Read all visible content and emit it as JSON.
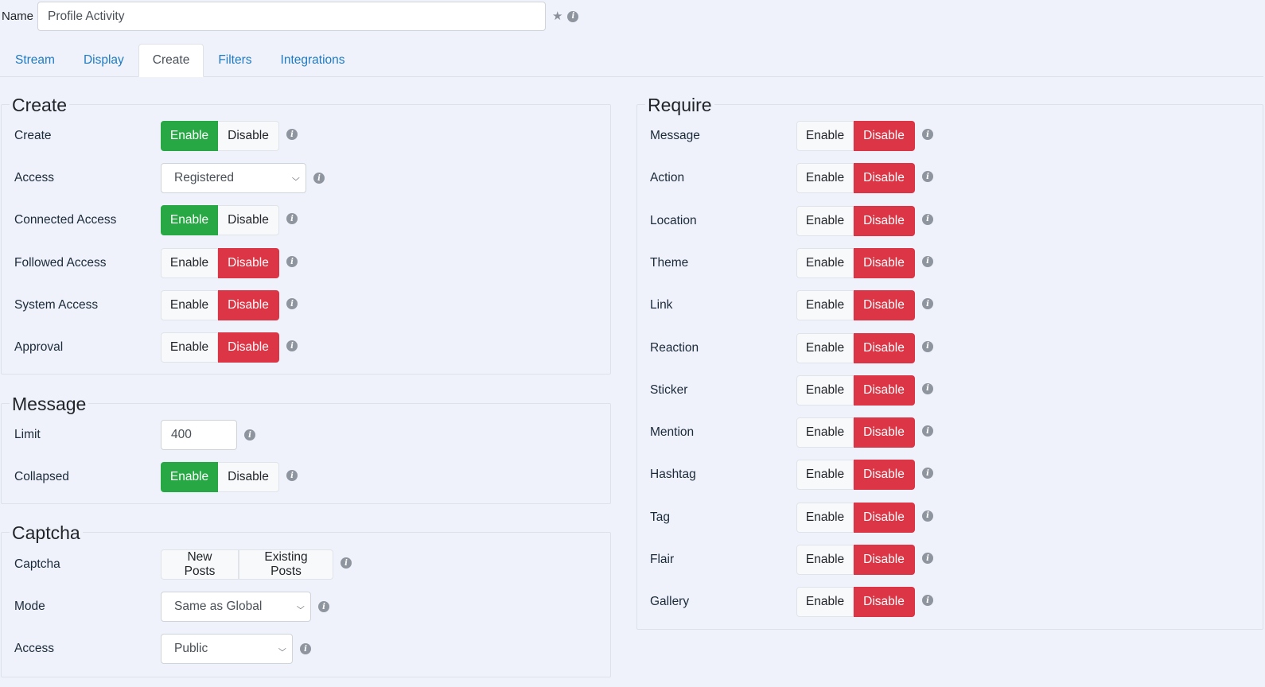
{
  "name_field": {
    "label": "Name",
    "value": "Profile Activity",
    "icons": [
      "star-icon",
      "info-icon"
    ]
  },
  "tabs": [
    {
      "label": "Stream",
      "active": false
    },
    {
      "label": "Display",
      "active": false
    },
    {
      "label": "Create",
      "active": true
    },
    {
      "label": "Filters",
      "active": false
    },
    {
      "label": "Integrations",
      "active": false
    }
  ],
  "colors": {
    "enable_active": "#28a745",
    "disable_active": "#dc3545",
    "tab_link": "#1f7ac2",
    "background": "#eff2fa"
  },
  "create": {
    "legend": "Create",
    "rows": [
      {
        "label": "Create",
        "type": "toggle",
        "enable": "Enable",
        "disable": "Disable",
        "value": "enable"
      },
      {
        "label": "Access",
        "type": "select",
        "value": "Registered"
      },
      {
        "label": "Connected Access",
        "type": "toggle",
        "enable": "Enable",
        "disable": "Disable",
        "value": "enable"
      },
      {
        "label": "Followed Access",
        "type": "toggle",
        "enable": "Enable",
        "disable": "Disable",
        "value": "disable"
      },
      {
        "label": "System Access",
        "type": "toggle",
        "enable": "Enable",
        "disable": "Disable",
        "value": "disable"
      },
      {
        "label": "Approval",
        "type": "toggle",
        "enable": "Enable",
        "disable": "Disable",
        "value": "disable"
      }
    ]
  },
  "message": {
    "legend": "Message",
    "rows": [
      {
        "label": "Limit",
        "type": "number",
        "value": "400"
      },
      {
        "label": "Collapsed",
        "type": "toggle",
        "enable": "Enable",
        "disable": "Disable",
        "value": "enable"
      }
    ]
  },
  "captcha": {
    "legend": "Captcha",
    "rows": [
      {
        "label": "Captcha",
        "type": "multi",
        "options": [
          "New Posts",
          "Existing Posts"
        ]
      },
      {
        "label": "Mode",
        "type": "select",
        "value": "Same as Global"
      },
      {
        "label": "Access",
        "type": "select",
        "value": "Public"
      }
    ]
  },
  "require": {
    "legend": "Require",
    "rows": [
      {
        "label": "Message",
        "enable": "Enable",
        "disable": "Disable",
        "value": "disable"
      },
      {
        "label": "Action",
        "enable": "Enable",
        "disable": "Disable",
        "value": "disable"
      },
      {
        "label": "Location",
        "enable": "Enable",
        "disable": "Disable",
        "value": "disable"
      },
      {
        "label": "Theme",
        "enable": "Enable",
        "disable": "Disable",
        "value": "disable"
      },
      {
        "label": "Link",
        "enable": "Enable",
        "disable": "Disable",
        "value": "disable"
      },
      {
        "label": "Reaction",
        "enable": "Enable",
        "disable": "Disable",
        "value": "disable"
      },
      {
        "label": "Sticker",
        "enable": "Enable",
        "disable": "Disable",
        "value": "disable"
      },
      {
        "label": "Mention",
        "enable": "Enable",
        "disable": "Disable",
        "value": "disable"
      },
      {
        "label": "Hashtag",
        "enable": "Enable",
        "disable": "Disable",
        "value": "disable"
      },
      {
        "label": "Tag",
        "enable": "Enable",
        "disable": "Disable",
        "value": "disable"
      },
      {
        "label": "Flair",
        "enable": "Enable",
        "disable": "Disable",
        "value": "disable"
      },
      {
        "label": "Gallery",
        "enable": "Enable",
        "disable": "Disable",
        "value": "disable"
      }
    ]
  }
}
